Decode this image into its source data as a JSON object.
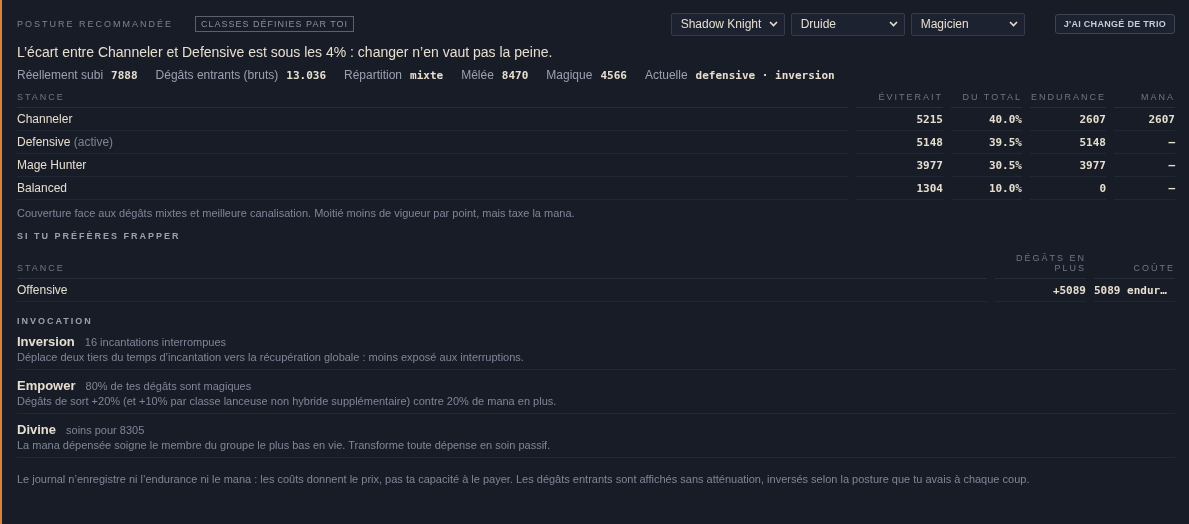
{
  "header": {
    "title": "POSTURE RECOMMANDÉE",
    "badge": "CLASSES DÉFINIES PAR TOI",
    "selects": [
      {
        "value": "Shadow Knight"
      },
      {
        "value": "Druide"
      },
      {
        "value": "Magicien"
      }
    ],
    "button": "J'AI CHANGÉ DE TRIO"
  },
  "headline": "L’écart entre Channeler et Defensive est sous les 4% : changer n’en vaut pas la peine.",
  "stats": [
    {
      "label": "Réellement subi",
      "value": "7888"
    },
    {
      "label": "Dégâts entrants (bruts)",
      "value": "13.036"
    },
    {
      "label": "Répartition",
      "value": "mixte"
    },
    {
      "label": "Mêlée",
      "value": "8470"
    },
    {
      "label": "Magique",
      "value": "4566"
    },
    {
      "label": "Actuelle",
      "value": "defensive · inversion"
    }
  ],
  "stance_table": {
    "columns": [
      "STANCE",
      "ÉVITERAIT",
      "DU TOTAL",
      "ENDURANCE",
      "MANA"
    ],
    "rows": [
      {
        "note": "",
        "cells": [
          "Channeler",
          "5215",
          "40.0%",
          "2607",
          "2607"
        ]
      },
      {
        "note": "(active)",
        "cells": [
          "Defensive",
          "5148",
          "39.5%",
          "5148",
          "–"
        ]
      },
      {
        "note": "",
        "cells": [
          "Mage Hunter",
          "3977",
          "30.5%",
          "3977",
          "–"
        ]
      },
      {
        "note": "",
        "cells": [
          "Balanced",
          "1304",
          "10.0%",
          "0",
          "–"
        ]
      }
    ]
  },
  "stance_description": "Couverture face aux dégâts mixtes et meilleure canalisation. Moitié moins de vigueur par point, mais taxe la mana.",
  "offense": {
    "title": "SI TU PRÉFÈRES FRAPPER",
    "columns": [
      "STANCE",
      "DÉGÂTS EN PLUS",
      "COÛTE"
    ],
    "rows": [
      {
        "cells": [
          "Offensive",
          "+5089",
          "5089 endur…"
        ]
      }
    ]
  },
  "invocation": {
    "title": "INVOCATION",
    "items": [
      {
        "name": "Inversion",
        "meta": "16 incantations interrompues",
        "description": "Déplace deux tiers du temps d’incantation vers la récupération globale : moins exposé aux interruptions."
      },
      {
        "name": "Empower",
        "meta": "80% de tes dégâts sont magiques",
        "description": "Dégâts de sort +20% (et +10% par classe lanceuse non hybride supplémentaire) contre 20% de mana en plus."
      },
      {
        "name": "Divine",
        "meta": "soins pour 8305",
        "description": "La mana dépensée soigne le membre du groupe le plus bas en vie. Transforme toute dépense en soin passif."
      }
    ]
  },
  "footer": "Le journal n’enregistre ni l’endurance ni le mana : les coûts donnent le prix, pas ta capacité à le payer. Les dégâts entrants sont affichés sans atténuation, inversés selon la posture que tu avais à chaque coup."
}
